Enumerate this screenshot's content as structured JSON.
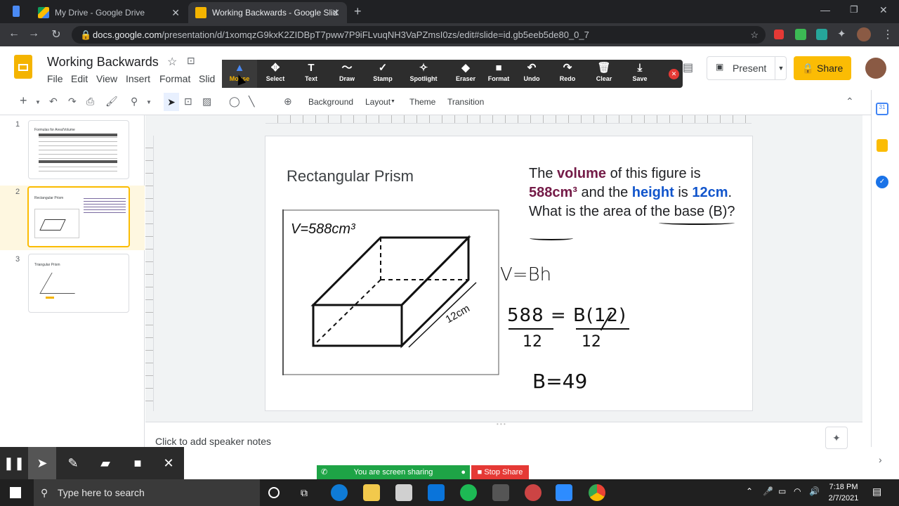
{
  "browser": {
    "tabs": [
      {
        "title": "My Drive - Google Drive",
        "active": false
      },
      {
        "title": "Working Backwards - Google Slid",
        "active": true
      }
    ],
    "url_host": "docs.google.com",
    "url_path": "/presentation/d/1xomqzG9kxK2ZIDBpT7pww7P9iFLvuqNH3VaPZmsI0zs/edit#slide=id.gb5eeb5de80_0_7"
  },
  "doc": {
    "title": "Working Backwards",
    "menu": [
      "File",
      "Edit",
      "View",
      "Insert",
      "Format",
      "Slid"
    ],
    "present_label": "Present",
    "share_label": "Share"
  },
  "annotation_toolbar": {
    "tools": [
      "Mouse",
      "Select",
      "Text",
      "Draw",
      "Stamp",
      "Spotlight",
      "Eraser",
      "Format",
      "Undo",
      "Redo",
      "Clear",
      "Save"
    ]
  },
  "editor_toolbar": {
    "background": "Background",
    "layout": "Layout",
    "theme": "Theme",
    "transition": "Transition"
  },
  "filmstrip": {
    "slides": [
      {
        "num": "1",
        "title": "Formulas for Area/Volume"
      },
      {
        "num": "2",
        "title": "Rectangular Prism"
      },
      {
        "num": "3",
        "title": "Triangular Prism"
      }
    ]
  },
  "slide": {
    "title": "Rectangular Prism",
    "problem": {
      "p1": "The ",
      "volume": "volume",
      "p2": " of this figure is ",
      "volume_value": "588cm³",
      "p3": " and the ",
      "height": "height",
      "p4": " is ",
      "height_value": "12cm",
      "p5": ". What is the area of the base (B)?"
    },
    "handwriting": {
      "v_label": "V=588cm³",
      "edge_label": "12cm",
      "formula": "V=Bh",
      "equation": "588 = B(12)",
      "denominators": "12        12",
      "answer": "B=49"
    }
  },
  "notes": {
    "placeholder": "Click to add speaker notes"
  },
  "screen_share": {
    "sharing_text": "You are screen sharing",
    "stop_label": "Stop Share"
  },
  "taskbar": {
    "search_placeholder": "Type here to search",
    "time": "7:18 PM",
    "date": "2/7/2021"
  }
}
